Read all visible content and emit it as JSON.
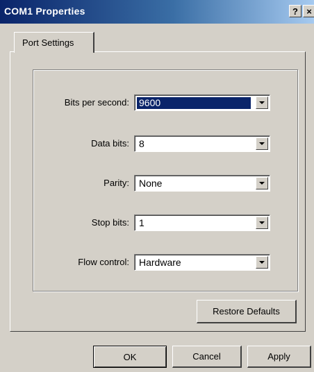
{
  "window": {
    "title": "COM1 Properties",
    "help_button": "?",
    "close_button": "×"
  },
  "tabs": [
    {
      "label": "Port Settings",
      "active": true
    }
  ],
  "fields": [
    {
      "label": "Bits per second:",
      "value": "9600",
      "selected": true
    },
    {
      "label": "Data bits:",
      "value": "8"
    },
    {
      "label": "Parity:",
      "value": "None"
    },
    {
      "label": "Stop bits:",
      "value": "1"
    },
    {
      "label": "Flow control:",
      "value": "Hardware"
    }
  ],
  "buttons": {
    "restore_defaults": "Restore Defaults",
    "ok": "OK",
    "cancel": "Cancel",
    "apply": "Apply"
  },
  "colors": {
    "title_gradient_start": "#0a246a",
    "title_gradient_end": "#a6caf0",
    "dialog_face": "#d4d0c8",
    "selection": "#0a246a"
  }
}
